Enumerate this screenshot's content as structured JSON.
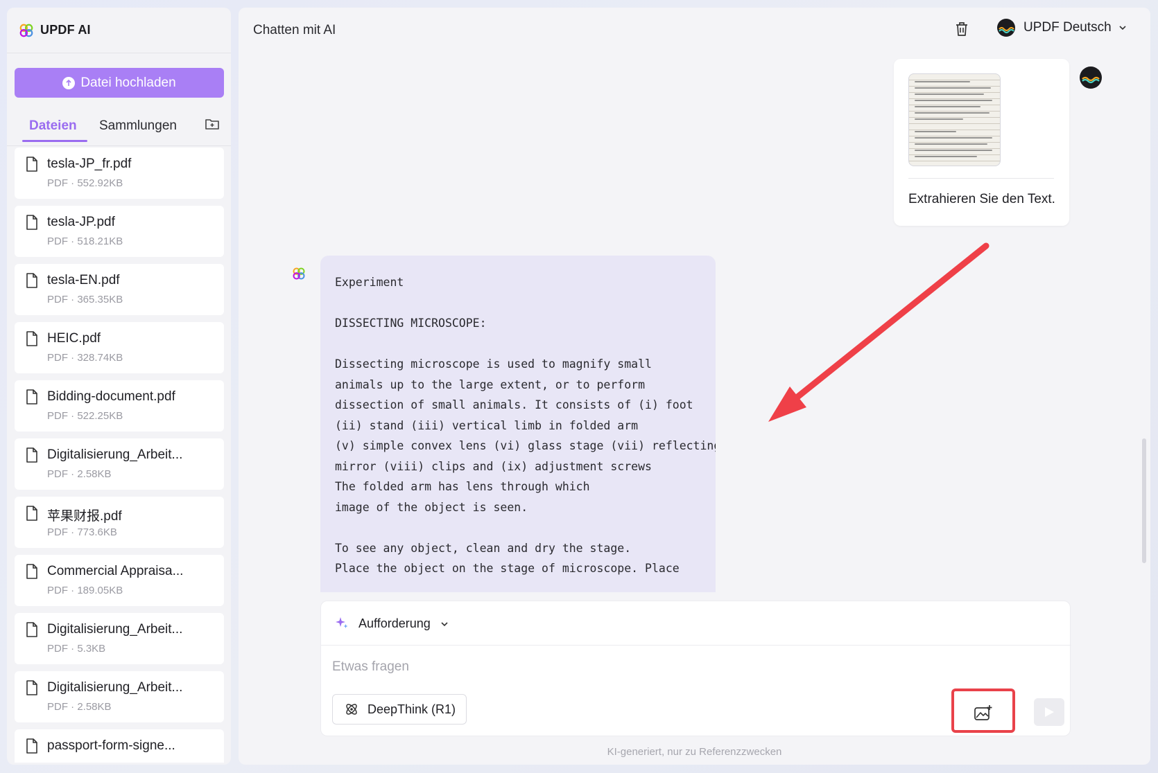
{
  "sidebar": {
    "brand": "UPDF AI",
    "upload_label": "Datei hochladen",
    "tabs": [
      {
        "label": "Dateien",
        "active": true
      },
      {
        "label": "Sammlungen",
        "active": false
      }
    ],
    "files": [
      {
        "name": "tesla-JP_fr.pdf",
        "meta": "PDF · 552.92KB"
      },
      {
        "name": "tesla-JP.pdf",
        "meta": "PDF · 518.21KB"
      },
      {
        "name": "tesla-EN.pdf",
        "meta": "PDF · 365.35KB"
      },
      {
        "name": "HEIC.pdf",
        "meta": "PDF · 328.74KB"
      },
      {
        "name": "Bidding-document.pdf",
        "meta": "PDF · 522.25KB"
      },
      {
        "name": "Digitalisierung_Arbeit...",
        "meta": "PDF · 2.58KB"
      },
      {
        "name": "苹果财报.pdf",
        "meta": "PDF · 773.6KB"
      },
      {
        "name": "Commercial Appraisa...",
        "meta": "PDF · 189.05KB"
      },
      {
        "name": "Digitalisierung_Arbeit...",
        "meta": "PDF · 5.3KB"
      },
      {
        "name": "Digitalisierung_Arbeit...",
        "meta": "PDF · 2.58KB"
      },
      {
        "name": "passport-form-signe...",
        "meta": ""
      }
    ]
  },
  "header": {
    "title": "Chatten mit AI",
    "account_name": "UPDF Deutsch"
  },
  "chat": {
    "user_message": "Extrahieren Sie den Text.",
    "ai_response": "Experiment\n\nDISSECTING MICROSCOPE:\n\nDissecting microscope is used to magnify small\nanimals up to the large extent, or to perform\ndissection of small animals. It consists of (i) foot\n(ii) stand (iii) vertical limb in folded arm\n(v) simple convex lens (vi) glass stage (vii) reflecting\nmirror (viii) clips and (ix) adjustment screws\nThe folded arm has lens through which\nimage of the object is seen.\n\nTo see any object, clean and dry the stage.\nPlace the object on the stage of microscope. Place"
  },
  "composer": {
    "prompt_label": "Aufforderung",
    "placeholder": "Etwas fragen",
    "deepthink_label": "DeepThink (R1)"
  },
  "footnote": "KI-generiert, nur zu Referenzzwecken",
  "colors": {
    "accent": "#a97ff5",
    "accent_text": "#9a6cf0",
    "highlight": "#e9424a",
    "ai_bubble": "#e8e6f6"
  },
  "icons": [
    "updf-logo-icon",
    "upload-icon",
    "folder-add-icon",
    "document-icon",
    "trash-icon",
    "avatar-icon",
    "chevron-down-icon",
    "sparkle-icon",
    "deepthink-icon",
    "image-upload-icon",
    "send-icon"
  ]
}
